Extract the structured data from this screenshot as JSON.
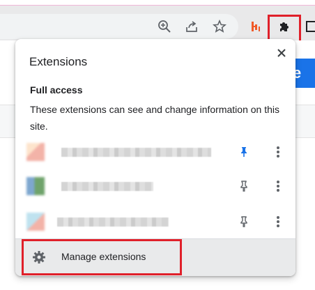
{
  "toolbar": {
    "icons": [
      "zoom-icon",
      "share-icon",
      "bookmark-star-icon",
      "extension-app-icon",
      "puzzle-icon",
      "side-panel-icon"
    ]
  },
  "popup": {
    "title": "Extensions",
    "close_icon": "close-icon",
    "full_access": {
      "heading": "Full access",
      "description": "These extensions can see and change information on this site."
    },
    "extensions": [
      {
        "pinned": true,
        "pin_icon": "pin-filled-icon",
        "more_icon": "more-vert-icon",
        "colors": [
          "#f3b3a8",
          "#fde4cc"
        ]
      },
      {
        "pinned": false,
        "pin_icon": "pin-outline-icon",
        "more_icon": "more-vert-icon",
        "colors": [
          "#7ea7cf",
          "#6fa36b"
        ]
      },
      {
        "pinned": false,
        "pin_icon": "pin-outline-icon",
        "more_icon": "more-vert-icon",
        "colors": [
          "#bfe2ef",
          "#f3b3a8"
        ]
      }
    ],
    "footer": {
      "manage_label": "Manage extensions",
      "icon": "gear-icon"
    }
  },
  "colors": {
    "accent_blue": "#1a73e8",
    "highlight_red": "#e0202a"
  }
}
